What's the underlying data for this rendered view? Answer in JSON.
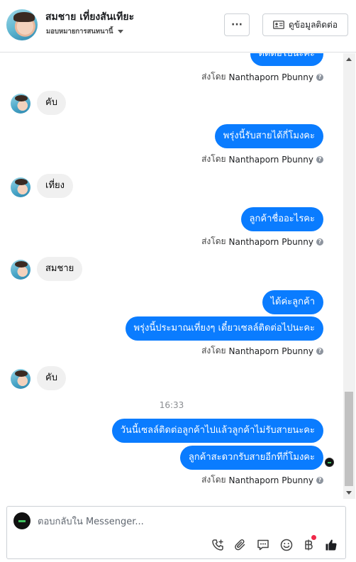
{
  "header": {
    "contact_name": "สมชาย เที่ยงสันเทียะ",
    "assign_label": "มอบหมายการสนทนานี้",
    "more_label": "···",
    "view_contact_label": "ดูข้อมูลติดต่อ"
  },
  "conversation": {
    "sender_prefix": "ส่งโดย",
    "sender_name": "Nanthaporn Pbunny",
    "help_glyph": "?",
    "messages": [
      {
        "direction": "out",
        "text": "ติดต่อไปนะคะ"
      },
      {
        "direction": "in",
        "text": "คับ"
      },
      {
        "direction": "out",
        "text": "พรุ่งนี้รับสายได้กี่โมงคะ"
      },
      {
        "direction": "in",
        "text": "เที่ยง"
      },
      {
        "direction": "out",
        "text": "ลูกค้าชื่ออะไรคะ"
      },
      {
        "direction": "in",
        "text": "สมชาย"
      },
      {
        "direction": "out",
        "text": "ได้ค่ะลูกค้า"
      },
      {
        "direction": "out",
        "text": "พรุ่งนี้ประมาณเที่ยงๆ เดี๋ยวเซลล์ติดต่อไปนะคะ"
      },
      {
        "direction": "in",
        "text": "คับ"
      },
      {
        "direction": "out",
        "text": "วันนี้เซลล์ติดต่อลูกค้าไปแล้วลูกค้าไม่รับสายนะคะ"
      },
      {
        "direction": "out",
        "text": "ลูกค้าสะดวกรับสายอีกทีกี่โมงคะ"
      }
    ],
    "timestamp": "16:33"
  },
  "composer": {
    "placeholder": "ตอบกลับใน Messenger..."
  },
  "icons": {
    "call_add": "phone-plus-icon",
    "attach": "paperclip-icon",
    "saved_reply": "chat-bubble-icon",
    "emoji": "smiley-icon",
    "payment": "baht-icon",
    "like": "thumbs-up-icon"
  },
  "colors": {
    "outgoing_bubble": "#0a7cff",
    "incoming_bubble": "#f0f0f0",
    "badge": "#f02849",
    "like": "#1c1e21"
  }
}
